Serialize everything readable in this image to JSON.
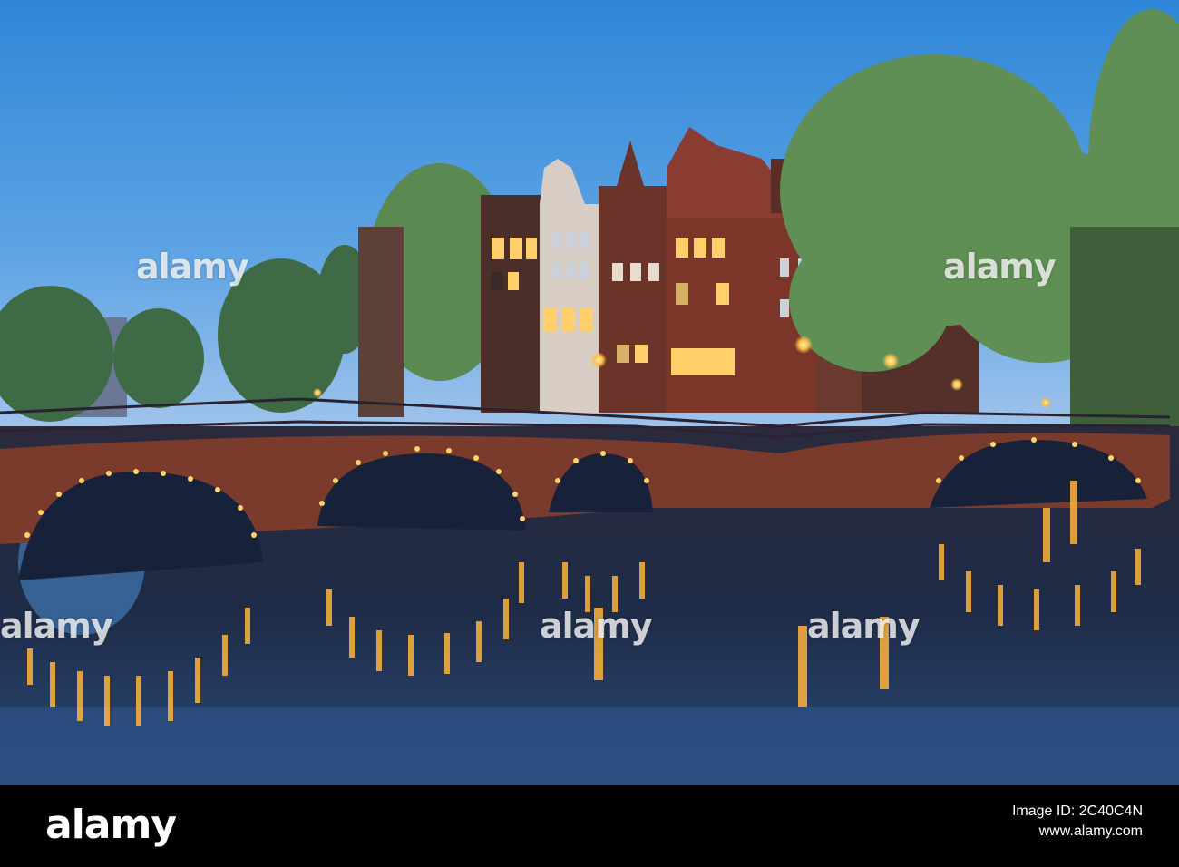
{
  "watermarks": {
    "brand": "alamy",
    "top_left": "alamy",
    "top_right": "alamy",
    "mid_left": "alamy",
    "mid_center": "alamy",
    "mid_right": "alamy"
  },
  "footer": {
    "logo": "alamy",
    "image_id": "Image ID: 2C40C4N",
    "url": "www.alamy.com"
  },
  "colors": {
    "sky_top": "#3d8fdc",
    "sky_bottom": "#7fb2e6",
    "water": "#1b2e4d",
    "brick": "#7a3a2c",
    "lights": "#ffc04a"
  }
}
